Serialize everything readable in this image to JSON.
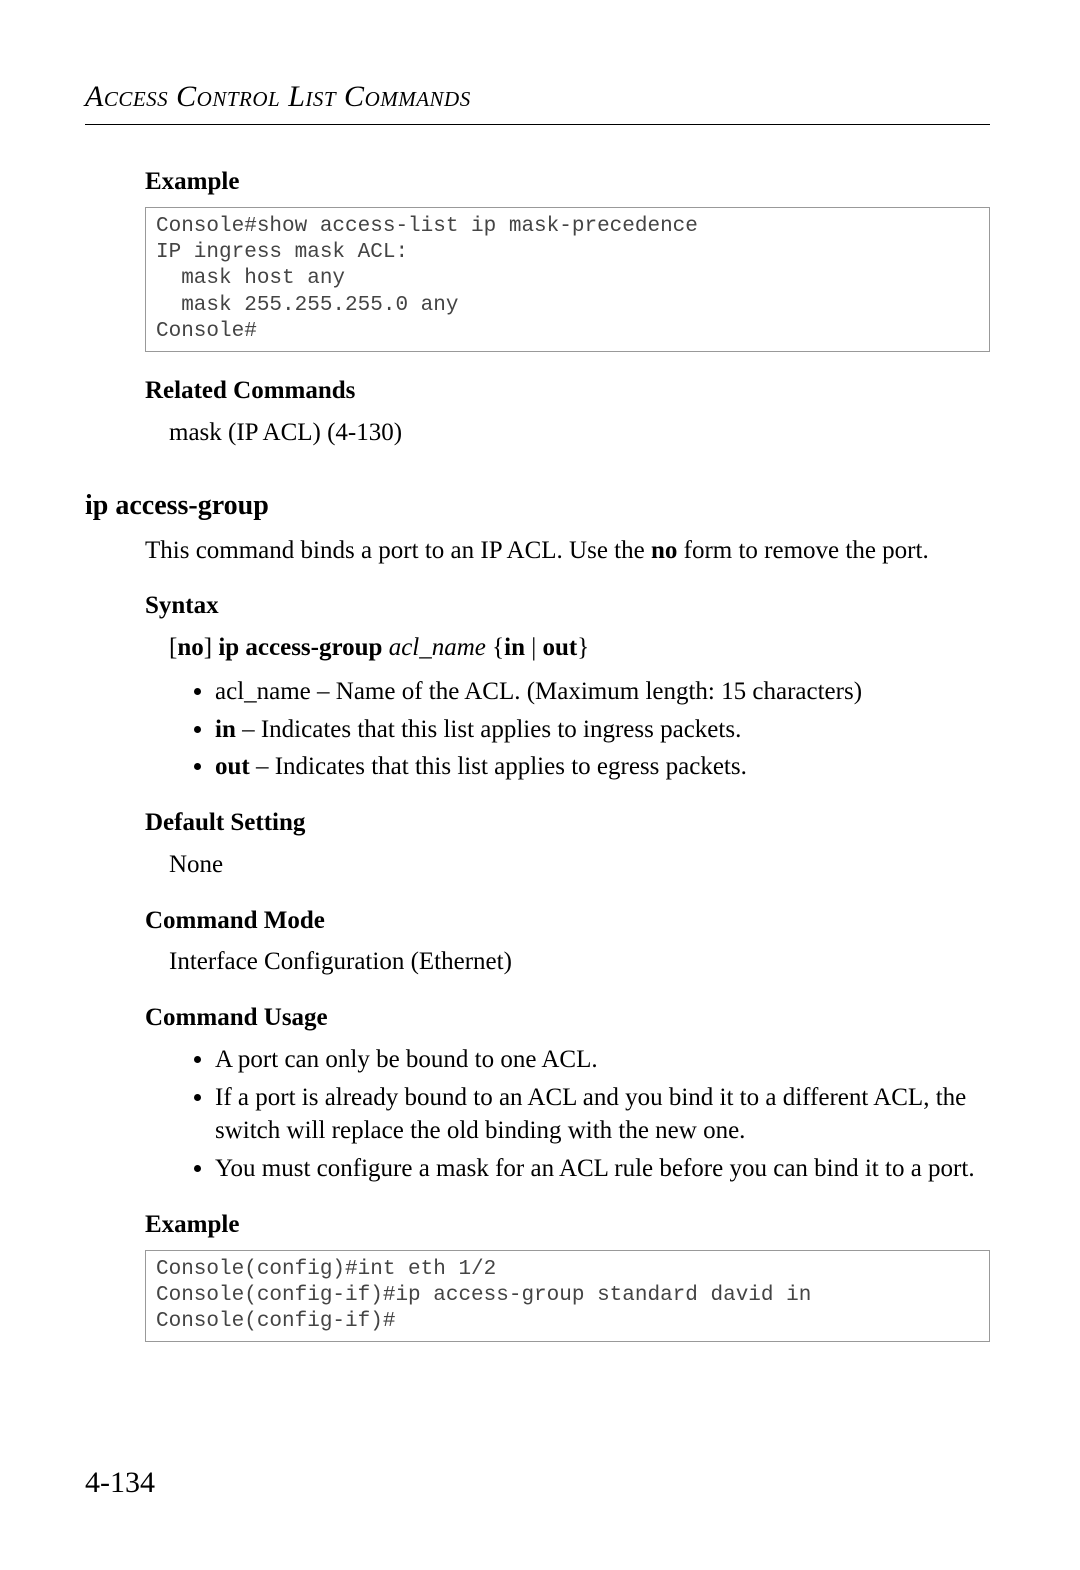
{
  "runningHead": "Access Control List Commands",
  "sections": {
    "example1": {
      "heading": "Example",
      "code": "Console#show access-list ip mask-precedence\nIP ingress mask ACL:\n  mask host any\n  mask 255.255.255.0 any\nConsole#"
    },
    "related": {
      "heading": "Related Commands",
      "text": "mask (IP ACL) (4-130)"
    },
    "command": {
      "title": "ip access-group",
      "intro_before": "This command binds a port to an IP ACL. Use the ",
      "intro_bold": "no",
      "intro_after": " form to remove the port."
    },
    "syntax": {
      "heading": "Syntax",
      "line": {
        "p1": "[",
        "p2_bold": "no",
        "p3": "] ",
        "p4_bold": "ip access-group",
        "p5_space": " ",
        "p6_italic": "acl_name",
        "p7": " {",
        "p8_bold": "in",
        "p9": " | ",
        "p10_bold": "out",
        "p11": "}"
      },
      "items": [
        {
          "bold": "",
          "italic": "acl_name",
          "text": " – Name of the ACL. (Maximum length: 15 characters)"
        },
        {
          "bold": "in",
          "italic": "",
          "text": " – Indicates that this list applies to ingress packets."
        },
        {
          "bold": "out",
          "italic": "",
          "text": " – Indicates that this list applies to egress packets."
        }
      ]
    },
    "defaultSetting": {
      "heading": "Default Setting",
      "text": "None"
    },
    "commandMode": {
      "heading": "Command Mode",
      "text": "Interface Configuration (Ethernet)"
    },
    "commandUsage": {
      "heading": "Command Usage",
      "items": [
        "A port can only be bound to one ACL.",
        "If a port is already bound to an ACL and you bind it to a different ACL, the switch will replace the old binding with the new one.",
        "You must configure a mask for an ACL rule before you can bind it to a port."
      ]
    },
    "example2": {
      "heading": "Example",
      "code": "Console(config)#int eth 1/2\nConsole(config-if)#ip access-group standard david in\nConsole(config-if)#"
    }
  },
  "pageNumber": "4-134"
}
